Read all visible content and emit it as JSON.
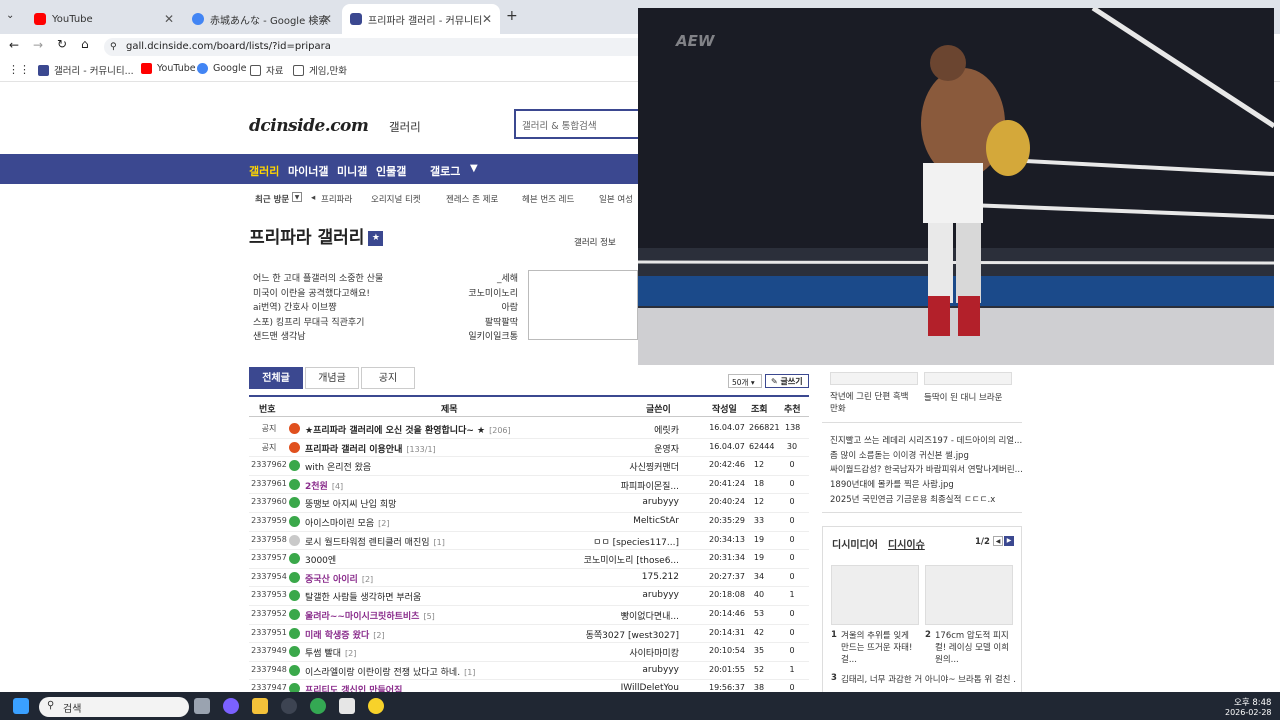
{
  "browser": {
    "tabs": [
      {
        "title": "YouTube",
        "color": "#ff0000"
      },
      {
        "title": "赤城あんな - Google 検索",
        "color": "#4285f4"
      },
      {
        "title": "프리파라 갤러리 - 커뮤니티 포",
        "color": "#3b4890"
      }
    ],
    "new_tab": "+",
    "url": "gall.dcinside.com/board/lists/?id=pripara",
    "bookmarks": [
      "갤러리 - 커뮤니티...",
      "YouTube",
      "Google",
      "자료",
      "게임,만화"
    ]
  },
  "site": {
    "logo": "dcinside.com",
    "logo_sub": "갤러리",
    "search_placeholder": "갤러리 & 통합검색",
    "nav": [
      "갤러리",
      "마이너갤",
      "미니갤",
      "인물갤",
      "갤로그"
    ],
    "recent_label": "최근 방문",
    "recent_items": [
      "프리파라",
      "오리지널 티켓",
      "젠레스 존 제로",
      "헤븐 번즈 레드",
      "일본 여성"
    ],
    "gallery_title": "프리파라 갤러리",
    "gallery_links": "갤러리 정보",
    "notices": [
      {
        "title": "어느 한 고대 플갤러의 소중한 산물",
        "writer": "_세해"
      },
      {
        "title": "미국이 이란을 공격했다고해요!",
        "writer": "코노미이노리"
      },
      {
        "title": "ai번역) 간호사 이브쨩",
        "writer": "아람"
      },
      {
        "title": "스포) 킹프리 무대극 직관후기",
        "writer": "팔딱팔딱"
      },
      {
        "title": "샌드맨 생각남",
        "writer": "일키이일크통"
      }
    ],
    "list_tabs": [
      "전체글",
      "개념글",
      "공지"
    ],
    "per_page": "50개",
    "write_button": "글쓰기",
    "columns": [
      "번호",
      "제목",
      "글쓴이",
      "작성일",
      "조회",
      "추천"
    ],
    "rows": [
      {
        "num": "공지",
        "type": "notice",
        "title": "★프리파라 갤러리에 오신 것을 환영합니다~ ★",
        "cmt": "[206]",
        "writer": "에릿카",
        "date": "16.04.07",
        "views": "266821",
        "rec": "138",
        "style": "bold"
      },
      {
        "num": "공지",
        "type": "notice",
        "title": "프리파라 갤러리 이용안내",
        "cmt": "[133/1]",
        "writer": "운영자",
        "date": "16.04.07",
        "views": "62444",
        "rec": "30",
        "style": "bold"
      },
      {
        "num": "2337962",
        "type": "normal",
        "title": "with 온리전 왔음",
        "cmt": "",
        "writer": "사신찡커맨더",
        "date": "20:42:46",
        "views": "12",
        "rec": "0",
        "style": ""
      },
      {
        "num": "2337961",
        "type": "normal",
        "title": "2천원",
        "cmt": "[4]",
        "writer": "파피파이몬질...",
        "date": "20:41:24",
        "views": "18",
        "rec": "0",
        "style": "purple"
      },
      {
        "num": "2337960",
        "type": "normal",
        "title": "뚱땡보 아지씨 난입 희망",
        "cmt": "",
        "writer": "arubyyy",
        "date": "20:40:24",
        "views": "12",
        "rec": "0",
        "style": ""
      },
      {
        "num": "2337959",
        "type": "normal",
        "title": "아이스마이린 모음",
        "cmt": "[2]",
        "writer": "MelticStAr",
        "date": "20:35:29",
        "views": "33",
        "rec": "0",
        "style": ""
      },
      {
        "num": "2337958",
        "type": "chat",
        "title": "로시 월드타워점 렌티클러 매진임",
        "cmt": "[1]",
        "writer": "ㅁㅁ [species117...]",
        "date": "20:34:13",
        "views": "19",
        "rec": "0",
        "style": ""
      },
      {
        "num": "2337957",
        "type": "normal",
        "title": "3000엔",
        "cmt": "",
        "writer": "코노미이노리 [those6...",
        "date": "20:31:34",
        "views": "19",
        "rec": "0",
        "style": ""
      },
      {
        "num": "2337954",
        "type": "normal",
        "title": "중국산 아이리",
        "cmt": "[2]",
        "writer": "175.212",
        "date": "20:27:37",
        "views": "34",
        "rec": "0",
        "style": "purple"
      },
      {
        "num": "2337953",
        "type": "normal",
        "title": "탈갤한 사람들 생각하면 부러움",
        "cmt": "",
        "writer": "arubyyy",
        "date": "20:18:08",
        "views": "40",
        "rec": "1",
        "style": ""
      },
      {
        "num": "2337952",
        "type": "normal",
        "title": "울려라~~마이시크릿하트비츠",
        "cmt": "[5]",
        "writer": "빵이없다면내...",
        "date": "20:14:46",
        "views": "53",
        "rec": "0",
        "style": "purple"
      },
      {
        "num": "2337951",
        "type": "normal",
        "title": "미래 학생증 왔다",
        "cmt": "[2]",
        "writer": "동쪽3027 [west3027]",
        "date": "20:14:31",
        "views": "42",
        "rec": "0",
        "style": "purple"
      },
      {
        "num": "2337949",
        "type": "normal",
        "title": "투썸 빨대",
        "cmt": "[2]",
        "writer": "사이타마미캉",
        "date": "20:10:54",
        "views": "35",
        "rec": "0",
        "style": ""
      },
      {
        "num": "2337948",
        "type": "normal",
        "title": "이스라엘이랑 이란이랑 전쟁 났다고 하네.",
        "cmt": "[1]",
        "writer": "arubyyy",
        "date": "20:01:55",
        "views": "52",
        "rec": "1",
        "style": ""
      },
      {
        "num": "2337947",
        "type": "normal",
        "title": "프리티도 갱신인 만들어짐",
        "cmt": "",
        "writer": "IWillDeletYou",
        "date": "19:56:37",
        "views": "38",
        "rec": "0",
        "style": "purple"
      }
    ],
    "right": {
      "card_captions": [
        "작년에 그린 단편 흑백 만화",
        "들딱이 된 대니 브라운"
      ],
      "list": [
        "진지빨고 쓰는 레데리 시리즈197 - 데드아이의 리얼...",
        "좀 많이 소름돋는 이이경 귀신본 썰.jpg",
        "싸이월드감성? 한국남자가 바람피워서 연탈나게버린...",
        "1890년대에 몰카를 찍은 사람.jpg",
        "2025년 국민연금 기금운용 최종실적 ㄷㄷㄷ.x"
      ],
      "section_tabs": [
        "디시미디어",
        "디시이슈"
      ],
      "pager": "1/2",
      "media": [
        {
          "n": "1",
          "t": "겨울의 추위를 잊게 만드는 뜨거운 자태! 걸..."
        },
        {
          "n": "2",
          "t": "176cm 압도적 피지컬! 레이싱 모델 이희원의..."
        },
        {
          "n": "3",
          "t": "김태리, 너무 과감한 거 아니야~ 브라톱 위 걸친 ..."
        }
      ]
    }
  },
  "video": {
    "watermark": "AEW"
  },
  "taskbar": {
    "search": "검색",
    "time": "오후 8:48",
    "date": "2026-02-28"
  },
  "colors": {
    "accent": "#3b4890",
    "purple_title": "#8a2c8c",
    "taskbar": "#202733"
  }
}
